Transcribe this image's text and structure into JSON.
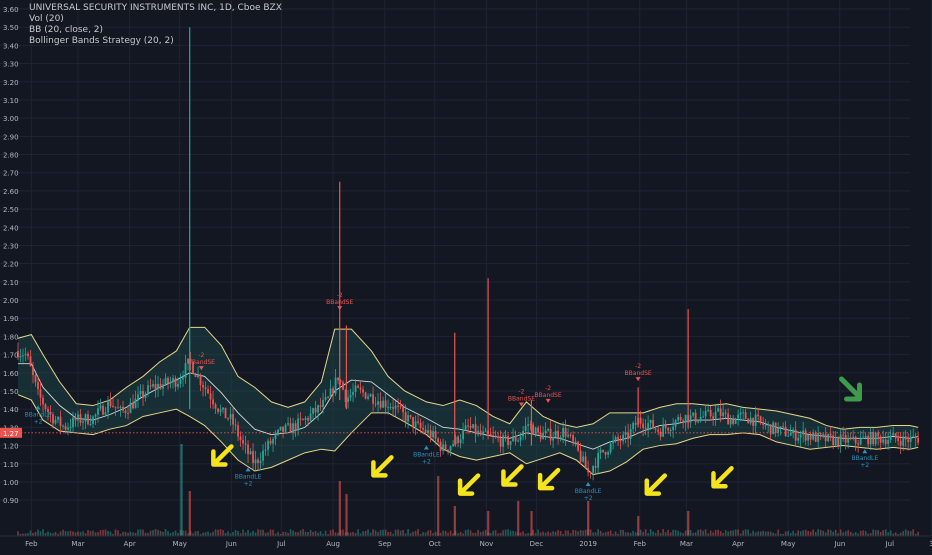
{
  "chart_data": {
    "type": "candlestick",
    "legend": [
      "UNIVERSAL SECURITY INSTRUMENTS INC, 1D, Cboe BZX",
      "Vol (20)",
      "BB (20, close, 2)",
      "Bollinger Bands Strategy (20, 2)"
    ],
    "ylim": [
      0.85,
      3.62
    ],
    "y_ticks": [
      "0.90",
      "1.00",
      "1.10",
      "1.20",
      "1.30",
      "1.40",
      "1.50",
      "1.60",
      "1.70",
      "1.80",
      "1.90",
      "2.00",
      "2.10",
      "2.20",
      "2.30",
      "2.40",
      "2.50",
      "2.60",
      "2.70",
      "2.80",
      "2.90",
      "3.00",
      "3.10",
      "3.20",
      "3.30",
      "3.40",
      "3.50",
      "3.60"
    ],
    "last_price": {
      "label": "1.27",
      "value": 1.27
    },
    "x_range_days": [
      0,
      545
    ],
    "x_ticks": [
      {
        "label": "Feb",
        "day": 8
      },
      {
        "label": "Mar",
        "day": 36
      },
      {
        "label": "Apr",
        "day": 67
      },
      {
        "label": "May",
        "day": 97
      },
      {
        "label": "Jun",
        "day": 128
      },
      {
        "label": "Jul",
        "day": 158
      },
      {
        "label": "Aug",
        "day": 189
      },
      {
        "label": "Sep",
        "day": 220
      },
      {
        "label": "Oct",
        "day": 250
      },
      {
        "label": "Nov",
        "day": 281
      },
      {
        "label": "Dec",
        "day": 311
      },
      {
        "label": "2019",
        "day": 342
      },
      {
        "label": "Feb",
        "day": 373
      },
      {
        "label": "Mar",
        "day": 401
      },
      {
        "label": "Apr",
        "day": 432
      },
      {
        "label": "May",
        "day": 462
      },
      {
        "label": "Jun",
        "day": 493
      },
      {
        "label": "Jul",
        "day": 523
      },
      {
        "label": "3",
        "day": 548
      }
    ],
    "bollinger": {
      "upper": [
        [
          0,
          1.79
        ],
        [
          8,
          1.81
        ],
        [
          15,
          1.7
        ],
        [
          25,
          1.55
        ],
        [
          35,
          1.43
        ],
        [
          45,
          1.42
        ],
        [
          55,
          1.45
        ],
        [
          65,
          1.52
        ],
        [
          75,
          1.58
        ],
        [
          85,
          1.66
        ],
        [
          95,
          1.72
        ],
        [
          103,
          1.85
        ],
        [
          112,
          1.85
        ],
        [
          122,
          1.75
        ],
        [
          132,
          1.58
        ],
        [
          142,
          1.52
        ],
        [
          152,
          1.44
        ],
        [
          162,
          1.41
        ],
        [
          172,
          1.44
        ],
        [
          182,
          1.55
        ],
        [
          190,
          1.84
        ],
        [
          200,
          1.84
        ],
        [
          212,
          1.72
        ],
        [
          222,
          1.58
        ],
        [
          232,
          1.5
        ],
        [
          245,
          1.44
        ],
        [
          255,
          1.42
        ],
        [
          265,
          1.45
        ],
        [
          275,
          1.42
        ],
        [
          285,
          1.36
        ],
        [
          295,
          1.32
        ],
        [
          305,
          1.44
        ],
        [
          315,
          1.36
        ],
        [
          325,
          1.32
        ],
        [
          335,
          1.3
        ],
        [
          345,
          1.32
        ],
        [
          355,
          1.38
        ],
        [
          365,
          1.38
        ],
        [
          375,
          1.38
        ],
        [
          385,
          1.41
        ],
        [
          395,
          1.43
        ],
        [
          405,
          1.43
        ],
        [
          415,
          1.42
        ],
        [
          425,
          1.43
        ],
        [
          435,
          1.41
        ],
        [
          445,
          1.4
        ],
        [
          455,
          1.39
        ],
        [
          465,
          1.37
        ],
        [
          475,
          1.35
        ],
        [
          485,
          1.31
        ],
        [
          495,
          1.29
        ],
        [
          505,
          1.3
        ],
        [
          515,
          1.3
        ],
        [
          525,
          1.31
        ],
        [
          535,
          1.31
        ],
        [
          540,
          1.3
        ]
      ],
      "middle": [
        [
          0,
          1.65
        ],
        [
          8,
          1.65
        ],
        [
          15,
          1.52
        ],
        [
          25,
          1.42
        ],
        [
          35,
          1.35
        ],
        [
          45,
          1.34
        ],
        [
          55,
          1.37
        ],
        [
          65,
          1.41
        ],
        [
          75,
          1.47
        ],
        [
          85,
          1.52
        ],
        [
          95,
          1.56
        ],
        [
          103,
          1.6
        ],
        [
          112,
          1.58
        ],
        [
          122,
          1.49
        ],
        [
          132,
          1.38
        ],
        [
          142,
          1.29
        ],
        [
          152,
          1.26
        ],
        [
          162,
          1.27
        ],
        [
          172,
          1.3
        ],
        [
          182,
          1.38
        ],
        [
          190,
          1.5
        ],
        [
          200,
          1.56
        ],
        [
          212,
          1.55
        ],
        [
          222,
          1.48
        ],
        [
          232,
          1.41
        ],
        [
          245,
          1.35
        ],
        [
          255,
          1.3
        ],
        [
          265,
          1.29
        ],
        [
          275,
          1.27
        ],
        [
          285,
          1.25
        ],
        [
          295,
          1.24
        ],
        [
          305,
          1.27
        ],
        [
          315,
          1.25
        ],
        [
          325,
          1.24
        ],
        [
          335,
          1.21
        ],
        [
          345,
          1.18
        ],
        [
          355,
          1.22
        ],
        [
          365,
          1.24
        ],
        [
          375,
          1.28
        ],
        [
          385,
          1.31
        ],
        [
          395,
          1.32
        ],
        [
          405,
          1.34
        ],
        [
          415,
          1.34
        ],
        [
          425,
          1.35
        ],
        [
          435,
          1.34
        ],
        [
          445,
          1.33
        ],
        [
          455,
          1.3
        ],
        [
          465,
          1.28
        ],
        [
          475,
          1.26
        ],
        [
          485,
          1.25
        ],
        [
          495,
          1.24
        ],
        [
          505,
          1.24
        ],
        [
          515,
          1.24
        ],
        [
          525,
          1.25
        ],
        [
          535,
          1.24
        ],
        [
          540,
          1.25
        ]
      ],
      "lower": [
        [
          0,
          1.48
        ],
        [
          8,
          1.45
        ],
        [
          15,
          1.34
        ],
        [
          25,
          1.28
        ],
        [
          35,
          1.27
        ],
        [
          45,
          1.26
        ],
        [
          55,
          1.29
        ],
        [
          65,
          1.31
        ],
        [
          75,
          1.36
        ],
        [
          85,
          1.38
        ],
        [
          95,
          1.4
        ],
        [
          103,
          1.36
        ],
        [
          112,
          1.31
        ],
        [
          122,
          1.22
        ],
        [
          132,
          1.12
        ],
        [
          142,
          1.06
        ],
        [
          152,
          1.08
        ],
        [
          162,
          1.12
        ],
        [
          172,
          1.16
        ],
        [
          182,
          1.18
        ],
        [
          190,
          1.17
        ],
        [
          200,
          1.27
        ],
        [
          212,
          1.38
        ],
        [
          222,
          1.38
        ],
        [
          232,
          1.33
        ],
        [
          245,
          1.26
        ],
        [
          255,
          1.18
        ],
        [
          265,
          1.14
        ],
        [
          275,
          1.12
        ],
        [
          285,
          1.14
        ],
        [
          295,
          1.16
        ],
        [
          305,
          1.1
        ],
        [
          315,
          1.13
        ],
        [
          325,
          1.16
        ],
        [
          335,
          1.12
        ],
        [
          345,
          1.04
        ],
        [
          355,
          1.06
        ],
        [
          365,
          1.11
        ],
        [
          375,
          1.18
        ],
        [
          385,
          1.2
        ],
        [
          395,
          1.21
        ],
        [
          405,
          1.24
        ],
        [
          415,
          1.26
        ],
        [
          425,
          1.26
        ],
        [
          435,
          1.27
        ],
        [
          445,
          1.26
        ],
        [
          455,
          1.22
        ],
        [
          465,
          1.2
        ],
        [
          475,
          1.18
        ],
        [
          485,
          1.19
        ],
        [
          495,
          1.2
        ],
        [
          505,
          1.19
        ],
        [
          515,
          1.18
        ],
        [
          525,
          1.19
        ],
        [
          535,
          1.18
        ],
        [
          540,
          1.19
        ]
      ]
    },
    "candle_anchors": [
      [
        0,
        1.72
      ],
      [
        5,
        1.7
      ],
      [
        12,
        1.48
      ],
      [
        20,
        1.36
      ],
      [
        28,
        1.3
      ],
      [
        35,
        1.34
      ],
      [
        45,
        1.35
      ],
      [
        55,
        1.44
      ],
      [
        62,
        1.38
      ],
      [
        70,
        1.44
      ],
      [
        80,
        1.52
      ],
      [
        88,
        1.54
      ],
      [
        96,
        1.56
      ],
      [
        103,
        1.66
      ],
      [
        108,
        1.58
      ],
      [
        115,
        1.48
      ],
      [
        122,
        1.38
      ],
      [
        128,
        1.34
      ],
      [
        135,
        1.2
      ],
      [
        142,
        1.1
      ],
      [
        150,
        1.2
      ],
      [
        158,
        1.28
      ],
      [
        165,
        1.3
      ],
      [
        172,
        1.34
      ],
      [
        180,
        1.4
      ],
      [
        186,
        1.45
      ],
      [
        192,
        1.58
      ],
      [
        197,
        1.46
      ],
      [
        203,
        1.5
      ],
      [
        210,
        1.48
      ],
      [
        218,
        1.44
      ],
      [
        225,
        1.42
      ],
      [
        232,
        1.36
      ],
      [
        240,
        1.3
      ],
      [
        248,
        1.26
      ],
      [
        255,
        1.18
      ],
      [
        262,
        1.22
      ],
      [
        270,
        1.3
      ],
      [
        277,
        1.26
      ],
      [
        285,
        1.24
      ],
      [
        292,
        1.22
      ],
      [
        300,
        1.24
      ],
      [
        306,
        1.32
      ],
      [
        312,
        1.26
      ],
      [
        320,
        1.26
      ],
      [
        328,
        1.28
      ],
      [
        335,
        1.18
      ],
      [
        342,
        1.05
      ],
      [
        350,
        1.16
      ],
      [
        358,
        1.22
      ],
      [
        365,
        1.24
      ],
      [
        372,
        1.34
      ],
      [
        378,
        1.32
      ],
      [
        385,
        1.28
      ],
      [
        392,
        1.32
      ],
      [
        399,
        1.36
      ],
      [
        405,
        1.35
      ],
      [
        412,
        1.36
      ],
      [
        420,
        1.38
      ],
      [
        428,
        1.34
      ],
      [
        435,
        1.36
      ],
      [
        442,
        1.34
      ],
      [
        450,
        1.3
      ],
      [
        458,
        1.28
      ],
      [
        465,
        1.26
      ],
      [
        472,
        1.26
      ],
      [
        480,
        1.24
      ],
      [
        488,
        1.23
      ],
      [
        495,
        1.23
      ],
      [
        502,
        1.22
      ],
      [
        510,
        1.24
      ],
      [
        518,
        1.24
      ],
      [
        525,
        1.24
      ],
      [
        532,
        1.23
      ],
      [
        540,
        1.24
      ]
    ],
    "spikes": [
      {
        "day": 103,
        "high": 3.5,
        "low": 1.4
      },
      {
        "day": 193,
        "high": 2.65,
        "low": 1.45
      },
      {
        "day": 197,
        "high": 1.86,
        "low": 1.4
      },
      {
        "day": 282,
        "high": 2.12,
        "low": 1.25
      },
      {
        "day": 262,
        "high": 1.82,
        "low": 1.2
      },
      {
        "day": 308,
        "high": 1.45,
        "low": 1.2
      },
      {
        "day": 372,
        "high": 1.52,
        "low": 1.3
      },
      {
        "day": 402,
        "high": 1.95,
        "low": 1.3
      }
    ],
    "volume_spikes": [
      {
        "day": 98,
        "size": 0.92
      },
      {
        "day": 103,
        "size": 0.45
      },
      {
        "day": 193,
        "size": 0.55
      },
      {
        "day": 197,
        "size": 0.42
      },
      {
        "day": 252,
        "size": 0.6
      },
      {
        "day": 262,
        "size": 0.3
      },
      {
        "day": 282,
        "size": 0.25
      },
      {
        "day": 308,
        "size": 0.25
      },
      {
        "day": 342,
        "size": 0.35
      },
      {
        "day": 372,
        "size": 0.2
      },
      {
        "day": 402,
        "size": 0.25
      },
      {
        "day": 300,
        "size": 0.35
      }
    ],
    "signals": [
      {
        "label": "BBandLE",
        "count": "+2",
        "day": 12,
        "price": 1.42,
        "side": "long"
      },
      {
        "label": "BBandLE",
        "count": "+2",
        "day": 138,
        "price": 1.08,
        "side": "long"
      },
      {
        "label": "BBandLE",
        "count": "+2",
        "day": 245,
        "price": 1.2,
        "side": "long"
      },
      {
        "label": "BBandLE",
        "count": "+2",
        "day": 342,
        "price": 1.0,
        "side": "long"
      },
      {
        "label": "BBandLE",
        "count": "+2",
        "day": 508,
        "price": 1.18,
        "side": "long"
      },
      {
        "label": "BBandSE",
        "count": "-2",
        "day": 110,
        "price": 1.62,
        "side": "short"
      },
      {
        "label": "BBandSE",
        "count": "-2",
        "day": 193,
        "price": 1.95,
        "side": "short"
      },
      {
        "label": "BBandSE",
        "count": "-2",
        "day": 318,
        "price": 1.44,
        "side": "short"
      },
      {
        "label": "BBandSE",
        "count": "-2",
        "day": 302,
        "price": 1.42,
        "side": "short"
      },
      {
        "label": "BBandSE",
        "count": "-2",
        "day": 372,
        "price": 1.56,
        "side": "short"
      }
    ],
    "annotations": [
      {
        "color": "yellow",
        "day": 122,
        "price": 1.14
      },
      {
        "color": "yellow",
        "day": 218,
        "price": 1.08
      },
      {
        "color": "yellow",
        "day": 270,
        "price": 0.98
      },
      {
        "color": "yellow",
        "day": 296,
        "price": 1.03
      },
      {
        "color": "yellow",
        "day": 318,
        "price": 1.01
      },
      {
        "color": "yellow",
        "day": 382,
        "price": 0.98
      },
      {
        "color": "yellow",
        "day": 422,
        "price": 1.02
      },
      {
        "color": "green",
        "day": 500,
        "price": 1.5
      }
    ],
    "colors": {
      "background": "#131722",
      "grid": "#1f2433",
      "axis_text": "#b2b5be",
      "up": "#26a69a",
      "down": "#ef5350",
      "band": "#e6d78a",
      "basis": "#d8d8d8",
      "band_fill": "#1d4b4b",
      "last_price_bg": "#ef5350",
      "annotation_yellow": "#f5e31b",
      "annotation_green": "#3d9b4b",
      "long_signal": "#2b93b8",
      "short_signal": "#ef5350"
    }
  }
}
